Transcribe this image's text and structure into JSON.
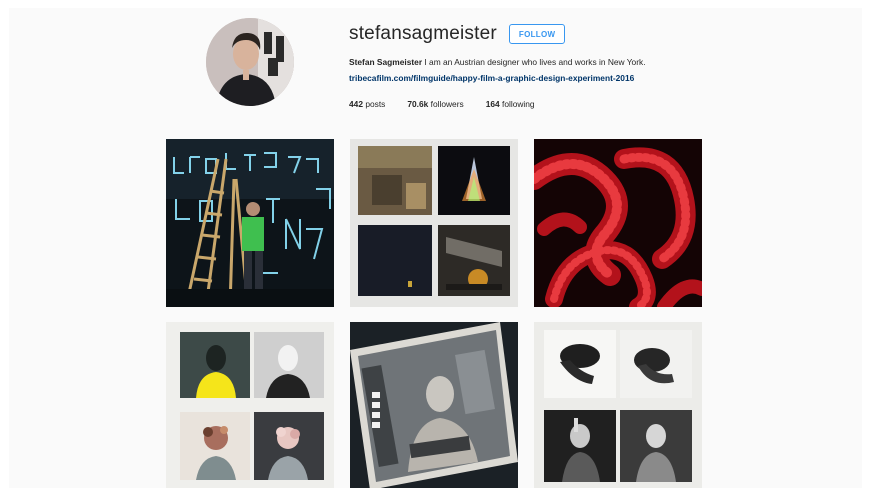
{
  "profile": {
    "username": "stefansagmeister",
    "follow_label": "FOLLOW",
    "full_name": "Stefan Sagmeister",
    "bio": " I am an Austrian designer who lives and works in New York.",
    "link": "tribecafilm.com/filmguide/happy-film-a-graphic-design-experiment-2016",
    "stats": {
      "posts_count": "442",
      "posts_label": "posts",
      "followers_count": "70.6k",
      "followers_label": "followers",
      "following_count": "164",
      "following_label": "following"
    }
  },
  "colors": {
    "accent": "#3897f0",
    "link": "#003569",
    "background": "#fafafa",
    "text": "#262626"
  },
  "posts": [
    {
      "subject": "neon-lettering-installation-with-ladders"
    },
    {
      "subject": "four-album-covers-grid"
    },
    {
      "subject": "red-octopus-tentacles"
    },
    {
      "subject": "four-portrait-prints-grid"
    },
    {
      "subject": "black-and-white-portrait-print"
    },
    {
      "subject": "four-black-and-white-photos-grid"
    }
  ]
}
